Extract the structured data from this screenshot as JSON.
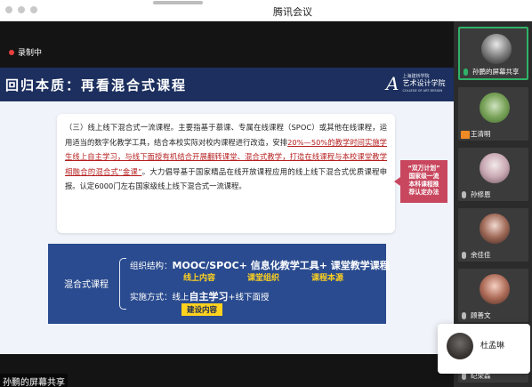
{
  "app": {
    "title": "腾讯会议"
  },
  "recording": {
    "label": "录制中"
  },
  "slide": {
    "title": "回归本质：再看混合式课程",
    "logo": {
      "line1": "上海建桥学院",
      "line2": "艺术设计学院",
      "line3": "COLLEGE OF ART DESIGN"
    },
    "paragraph": {
      "part1": "（三）线上线下混合式一流课程。主要指基于慕课、专属在线课程（SPOC）或其他在线课程，运用适当的数字化教学工具，结合本校实际对校内课程进行改造，安排",
      "part2": "20%—50%的教学时间实施学生线上自主学习，与线下面授有机结合开展翻转课堂、混合式教学，打造在线课程与本校课堂教学相融合的混合式“金课”",
      "part3": "。大力倡导基于国家精品在线开放课程应用的线上线下混合式优质课程申报。认定6000门左右国家级线上线下混合式一流课程。"
    },
    "callout": {
      "line1": "“双万计划”",
      "line2": "国家级一流",
      "line3": "本科课程推",
      "line4": "荐认定办法"
    },
    "box": {
      "label": "混合式课程",
      "org_prefix": "组织结构：",
      "org_items": "MOOC/SPOC+ 信息化教学工具+ 课堂教学课程",
      "tag1": "线上内容",
      "tag2": "课堂组织",
      "tag3": "课程本源",
      "impl_prefix": "实施方式：线上",
      "impl_bold": "自主学习",
      "impl_suffix": "+线下面授",
      "impl_tag": "建设内容"
    }
  },
  "share_label": "孙鹏的屏幕共享",
  "participants": [
    {
      "name": "孙鹏的屏幕共享",
      "active": true
    },
    {
      "name": "王清明",
      "active": false
    },
    {
      "name": "孙修恩",
      "active": false
    },
    {
      "name": "余佳佳",
      "active": false
    },
    {
      "name": "顾善文",
      "active": false
    },
    {
      "name": "纪荣森",
      "active": false
    }
  ],
  "popup": {
    "name": "杜孟琳"
  }
}
